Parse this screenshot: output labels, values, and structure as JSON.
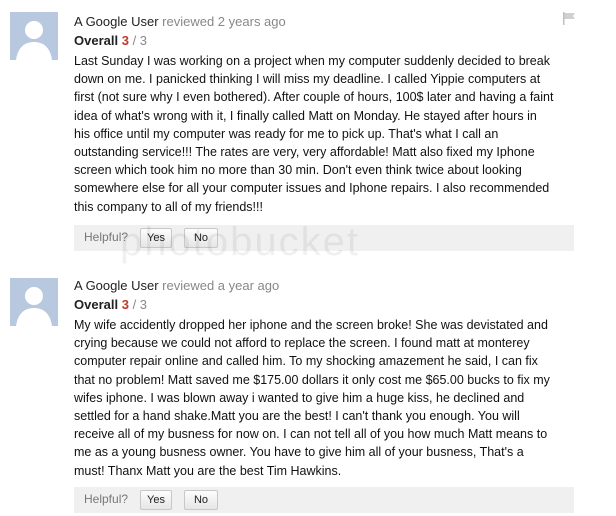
{
  "reviews": [
    {
      "author": "A Google User",
      "meta": "reviewed 2 years ago",
      "overall_label": "Overall",
      "score": "3",
      "max": "/ 3",
      "lines": [
        "Last Sunday I was working on a project when my computer suddenly decided to break",
        "down on me. I panicked thinking I will miss my deadline. I called Yippie computers at",
        "first (not sure why I even bothered). After couple of hours, 100$ later and having a faint",
        "idea of what's wrong with it, I finally called Matt on Monday. He stayed after hours in",
        "his office until my computer was ready for me to pick up. That's what I call an",
        "outstanding service!!! The rates are very, very affordable! Matt also fixed my Iphone",
        "screen which took him no more than 30 min. Don't even think twice about looking",
        "somewhere else for all your computer issues and Iphone repairs. I also recommended",
        "this company to all of my friends!!!"
      ],
      "helpful_label": "Helpful?",
      "yes_label": "Yes",
      "no_label": "No"
    },
    {
      "author": "A Google User",
      "meta": "reviewed a year ago",
      "overall_label": "Overall",
      "score": "3",
      "max": "/ 3",
      "lines": [
        "My wife accidently dropped her iphone and the screen broke! She was devistated and",
        "crying because we could not afford to replace the screen. I found matt at monterey",
        "computer repair online and called him. To my shocking amazement he said, I can fix",
        "that no problem! Matt saved me $175.00 dollars it only cost me $65.00 bucks to fix my",
        "wifes iphone. I was blown away i wanted to give him a huge kiss, he declined and",
        "settled for a hand shake.Matt you are the best! I can't thank you enough. You will",
        "receive all of my busness for now on. I can not tell all of you how much Matt means to",
        "me as a young busness owner. You have to give him all of your busness, That's a",
        "must! Thanx Matt you are the best Tim Hawkins."
      ],
      "helpful_label": "Helpful?",
      "yes_label": "Yes",
      "no_label": "No"
    }
  ],
  "watermark": "photobucket"
}
